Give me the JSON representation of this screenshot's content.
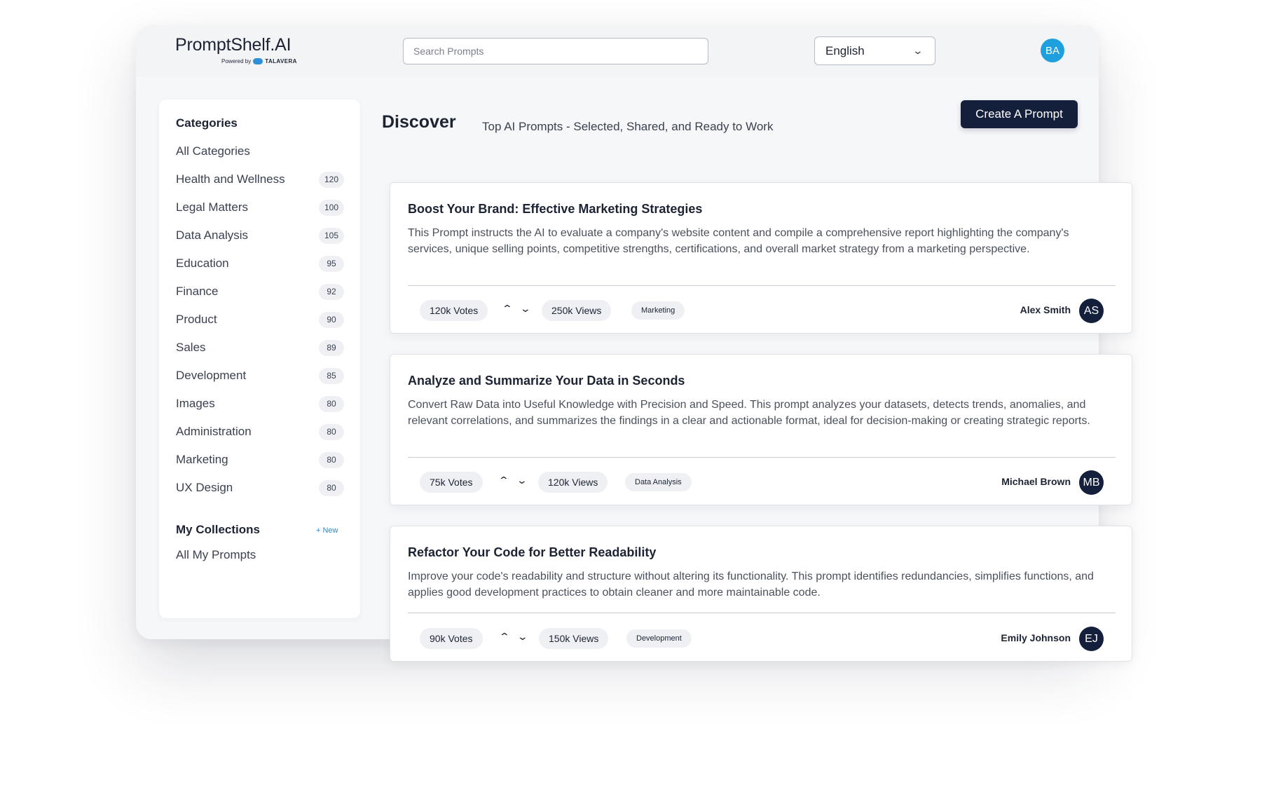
{
  "header": {
    "logo_text": "PromptShelf.AI",
    "powered_by": "Powered by",
    "powered_brand": "TALAVERA",
    "search_placeholder": "Search Prompts",
    "language": "English",
    "user_initials": "BA"
  },
  "sidebar": {
    "categories_heading": "Categories",
    "items": [
      {
        "label": "All Categories",
        "count": ""
      },
      {
        "label": "Health and Wellness",
        "count": "120"
      },
      {
        "label": "Legal Matters",
        "count": "100"
      },
      {
        "label": "Data Analysis",
        "count": "105"
      },
      {
        "label": "Education",
        "count": "95"
      },
      {
        "label": "Finance",
        "count": "92"
      },
      {
        "label": "Product",
        "count": "90"
      },
      {
        "label": "Sales",
        "count": "89"
      },
      {
        "label": "Development",
        "count": "85"
      },
      {
        "label": "Images",
        "count": "80"
      },
      {
        "label": "Administration",
        "count": "80"
      },
      {
        "label": "Marketing",
        "count": "80"
      },
      {
        "label": "UX Design",
        "count": "80"
      }
    ],
    "collections_heading": "My Collections",
    "new_label": "+ New",
    "collections": [
      {
        "label": "All My Prompts"
      }
    ]
  },
  "main": {
    "title": "Discover",
    "tagline": "Top AI Prompts - Selected, Shared, and Ready to Work",
    "create_button": "Create A Prompt"
  },
  "prompts": [
    {
      "title": "Boost Your Brand: Effective Marketing Strategies",
      "description": "This Prompt instructs the AI to evaluate a company's website content and compile a comprehensive report highlighting the company's services, unique selling points, competitive strengths, certifications, and overall market strategy from a marketing perspective.",
      "votes": "120k Votes",
      "views": "250k Views",
      "tag": "Marketing",
      "author": "Alex Smith",
      "author_initials": "AS"
    },
    {
      "title": "Analyze and Summarize Your Data in Seconds",
      "description": "Convert Raw Data into Useful Knowledge with Precision and Speed. This prompt analyzes your datasets, detects trends, anomalies, and relevant correlations, and summarizes the findings in a clear and actionable format, ideal for decision-making or creating strategic reports.",
      "votes": "75k Votes",
      "views": "120k Views",
      "tag": "Data Analysis",
      "author": "Michael Brown",
      "author_initials": "MB"
    },
    {
      "title": "Refactor Your Code for Better Readability",
      "description": "Improve your code's readability and structure without altering its functionality. This prompt identifies redundancies, simplifies functions, and applies good development practices to obtain cleaner and more maintainable code.",
      "votes": "90k Votes",
      "views": "150k Views",
      "tag": "Development",
      "author": "Emily Johnson",
      "author_initials": "EJ"
    }
  ],
  "icons": {
    "language_dropdown": "chevron-down-icon",
    "upvote": "chevron-up-icon",
    "downvote": "chevron-down-icon"
  },
  "colors": {
    "primary_dark": "#141f3c",
    "accent_blue": "#1e9fde"
  }
}
